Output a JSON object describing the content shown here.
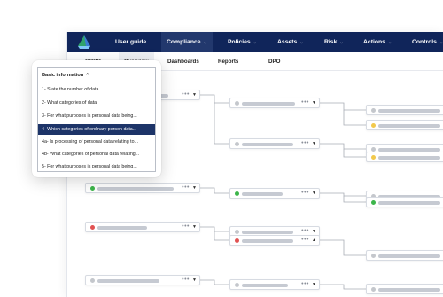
{
  "nav": {
    "items": [
      {
        "label": "User guide",
        "chevron": false
      },
      {
        "label": "Compliance",
        "chevron": true
      },
      {
        "label": "Policies",
        "chevron": true
      },
      {
        "label": "Assets",
        "chevron": true
      },
      {
        "label": "Risk",
        "chevron": true
      },
      {
        "label": "Actions",
        "chevron": true
      },
      {
        "label": "Controls",
        "chevron": true
      }
    ],
    "chevron_glyph": "⌄",
    "logo_icon": "logo-icon"
  },
  "subnav": {
    "items": [
      "GDPR",
      "Overview",
      "Dashboards",
      "Reports",
      "DPO"
    ]
  },
  "dropdown": {
    "header": "Basic information",
    "header_chevron": "^",
    "items": [
      "1- State the number of data",
      "2- What categories of data",
      "3- For what purposes is personal data being...",
      "4- Which categories of ordinary person data...",
      "4a- Is processing of personal data relating to...",
      "4b- What categories of personal data relating...",
      "5- For what purposes is personal data being..."
    ],
    "selected_index": 3
  },
  "node_menu_glyph": "•••",
  "node_caret_glyph": "▼",
  "node_caret_up_glyph": "▲",
  "status_colors": {
    "green": "#3cb54a",
    "red": "#e15252",
    "yellow": "#f2c94c",
    "grey": "#c4c7cc"
  },
  "accent_colors": {
    "nav_background": "#10255a",
    "selected_item": "#1d3468"
  }
}
